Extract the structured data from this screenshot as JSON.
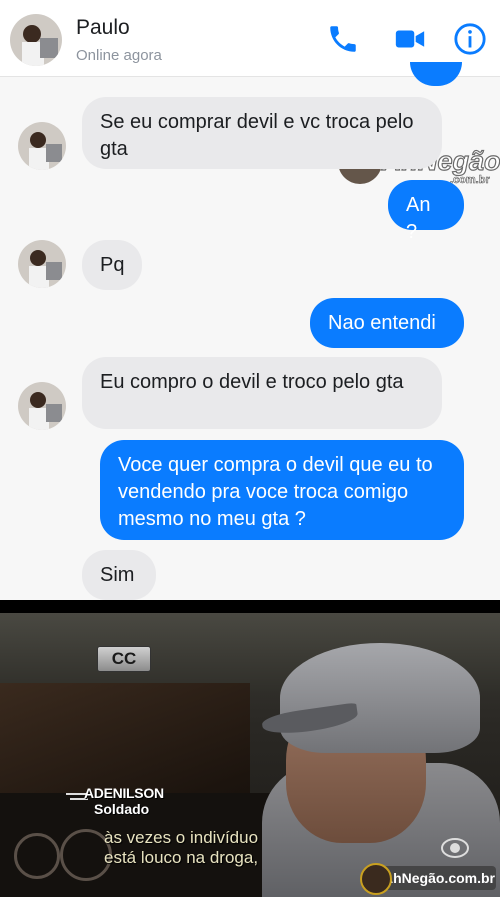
{
  "chat": {
    "contact_name": "Paulo",
    "contact_status": "Online agora",
    "header_icons": [
      "phone-icon",
      "video-camera-icon",
      "info-icon"
    ],
    "accent_color": "#0a7cff",
    "messages": [
      {
        "from": "contact",
        "text": "Se eu comprar devil e vc troca pelo gta"
      },
      {
        "from": "me",
        "text": "An ?"
      },
      {
        "from": "contact",
        "text": "Pq"
      },
      {
        "from": "me",
        "text": "Nao entendi"
      },
      {
        "from": "contact",
        "text": "Eu compro o devil e troco pelo gta"
      },
      {
        "from": "me",
        "text": "Voce quer compra o devil que eu to vendendo pra voce troca comigo mesmo no meu gta ?"
      },
      {
        "from": "contact",
        "text": "Sim"
      }
    ],
    "watermark": {
      "text": "AhNegão!",
      "sub": ".com.br"
    }
  },
  "tv": {
    "cc_label": "CC",
    "name": "ADENILSON",
    "role": "Soldado",
    "subtitle_line1": "às vezes o indivíduo",
    "subtitle_line2": "está louco na droga,",
    "site_label": "AhNegão.com.br"
  }
}
